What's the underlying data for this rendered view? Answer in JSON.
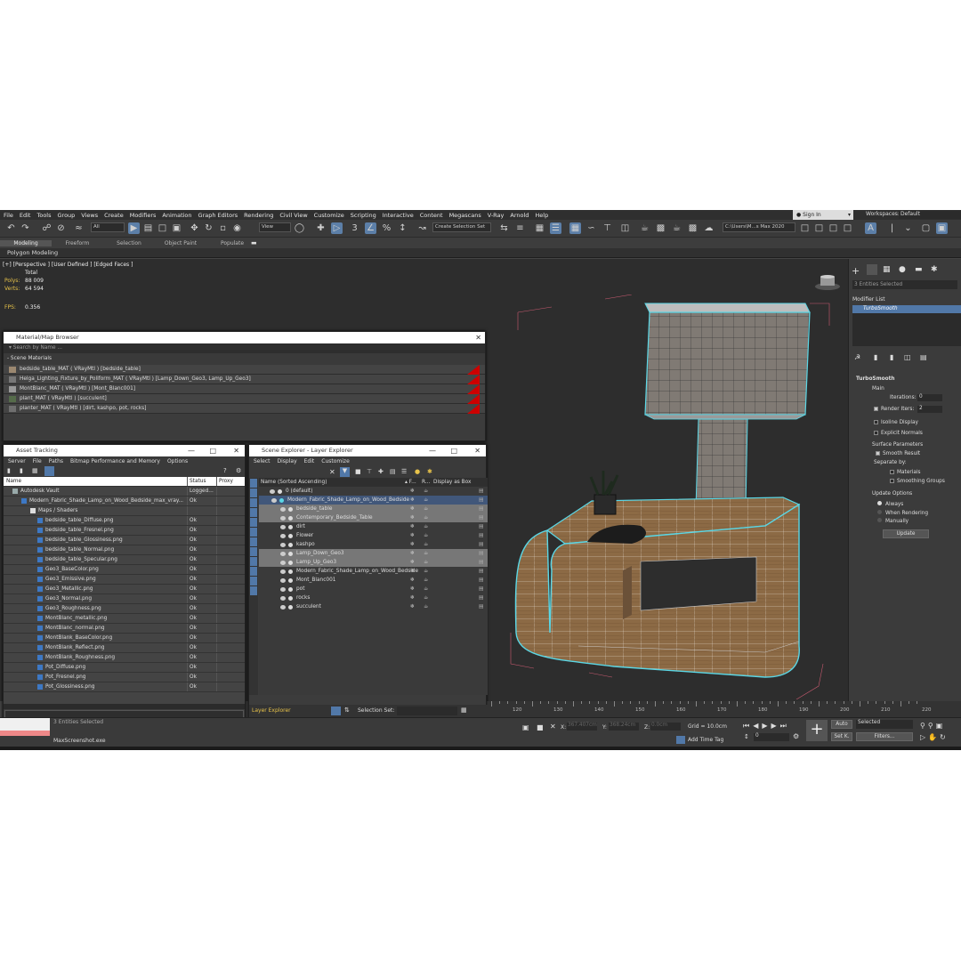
{
  "menu": [
    "File",
    "Edit",
    "Tools",
    "Group",
    "Views",
    "Create",
    "Modifiers",
    "Animation",
    "Graph Editors",
    "Rendering",
    "Civil View",
    "Customize",
    "Scripting",
    "Interactive",
    "Content",
    "Megascans",
    "V-Ray",
    "Arnold",
    "Help"
  ],
  "topright": {
    "sign_in": "Sign In",
    "workspaces_label": "Workspaces:",
    "workspaces_value": "Default"
  },
  "toolbar": {
    "filter": "All",
    "view": "View",
    "selection_set": "Create Selection Set",
    "path": "C:\\Users\\M...s Max 2020"
  },
  "ribbon": [
    "Modeling",
    "Freeform",
    "Selection",
    "Object Paint",
    "Populate"
  ],
  "polygon_modeling": "Polygon Modeling",
  "viewport": {
    "label": "[+] [Perspective ] [User Defined ] [Edged Faces ]",
    "total": "Total",
    "polys_label": "Polys:",
    "polys": "88 009",
    "verts_label": "Verts:",
    "verts": "64 594",
    "fps_label": "FPS:",
    "fps": "0.356"
  },
  "material_browser": {
    "title": "Material/Map Browser",
    "search_placeholder": "Search by Name ...",
    "section": "- Scene Materials",
    "items": [
      "bedside_table_MAT  ( VRayMtl )  [bedside_table]",
      "Helga_Lighting_Fixture_by_Poliform_MAT  ( VRayMtl )  [Lamp_Down_Geo3, Lamp_Up_Geo3]",
      "MontBlanc_MAT  ( VRayMtl )  [Mont_Blanc001]",
      "plant_MAT  ( VRayMtl )  [succulent]",
      "planter_MAT  ( VRayMtl )  [dirt, kashpo, pot, rocks]"
    ]
  },
  "asset_tracking": {
    "title": "Asset Tracking",
    "menu": [
      "Server",
      "File",
      "Paths",
      "Bitmap Performance and Memory",
      "Options"
    ],
    "columns": [
      "Name",
      "Status",
      "Proxy"
    ],
    "rows": [
      {
        "name": "Autodesk Vault",
        "status": "Logged..."
      },
      {
        "name": "Modern_Fabric_Shade_Lamp_on_Wood_Bedside_max_vray...",
        "status": "Ok"
      },
      {
        "name": "Maps / Shaders",
        "status": ""
      },
      {
        "name": "bedside_table_Diffuse.png",
        "status": "Ok"
      },
      {
        "name": "bedside_table_Fresnel.png",
        "status": "Ok"
      },
      {
        "name": "bedside_table_Glossiness.png",
        "status": "Ok"
      },
      {
        "name": "bedside_table_Normal.png",
        "status": "Ok"
      },
      {
        "name": "bedside_table_Specular.png",
        "status": "Ok"
      },
      {
        "name": "Geo3_BaseColor.png",
        "status": "Ok"
      },
      {
        "name": "Geo3_Emissive.png",
        "status": "Ok"
      },
      {
        "name": "Geo3_Metallic.png",
        "status": "Ok"
      },
      {
        "name": "Geo3_Normal.png",
        "status": "Ok"
      },
      {
        "name": "Geo3_Roughness.png",
        "status": "Ok"
      },
      {
        "name": "MontBlanc_metallic.png",
        "status": "Ok"
      },
      {
        "name": "MontBlanc_normal.png",
        "status": "Ok"
      },
      {
        "name": "MontBlank_BaseColor.png",
        "status": "Ok"
      },
      {
        "name": "MontBlank_Reflect.png",
        "status": "Ok"
      },
      {
        "name": "MontBlank_Roughness.png",
        "status": "Ok"
      },
      {
        "name": "Pot_Diffuse.png",
        "status": "Ok"
      },
      {
        "name": "Pot_Fresnel.png",
        "status": "Ok"
      },
      {
        "name": "Pot_Glossiness.png",
        "status": "Ok"
      }
    ]
  },
  "scene_explorer": {
    "title": "Scene Explorer - Layer Explorer",
    "menu": [
      "Select",
      "Display",
      "Edit",
      "Customize"
    ],
    "columns": [
      "Name (Sorted Ascending)",
      "▴ F...",
      "R...",
      "Display as Box"
    ],
    "rows": [
      {
        "name": "0 (default)",
        "indent": 1
      },
      {
        "name": "Modern_Fabric_Shade_Lamp_on_Wood_Bedside",
        "indent": 0
      },
      {
        "name": "bedside_table",
        "indent": 2
      },
      {
        "name": "Contemporary_Bedside_Table",
        "indent": 2
      },
      {
        "name": "dirt",
        "indent": 2
      },
      {
        "name": "Flower",
        "indent": 2
      },
      {
        "name": "kashpo",
        "indent": 2
      },
      {
        "name": "Lamp_Down_Geo3",
        "indent": 2
      },
      {
        "name": "Lamp_Up_Geo3",
        "indent": 2
      },
      {
        "name": "Modern_Fabric_Shade_Lamp_on_Wood_Bedside",
        "indent": 2
      },
      {
        "name": "Mont_Blanc001",
        "indent": 2
      },
      {
        "name": "pot",
        "indent": 2
      },
      {
        "name": "rocks",
        "indent": 2
      },
      {
        "name": "succulent",
        "indent": 2
      }
    ],
    "footer_label": "Layer Explorer",
    "selection_set_label": "Selection Set:"
  },
  "command_panel": {
    "selected_count": "3 Entities Selected",
    "modifier_list": "Modifier List",
    "modifier": "TurboSmooth",
    "rollout_title": "TurboSmooth",
    "main": "Main",
    "iterations_label": "Iterations:",
    "iterations": "0",
    "render_iters_label": "Render Iters:",
    "render_iters": "2",
    "isoline": "Isoline Display",
    "explicit_normals": "Explicit Normals",
    "surface_params": "Surface Parameters",
    "smooth_result": "Smooth Result",
    "separate_by": "Separate by:",
    "materials": "Materials",
    "smoothing_groups": "Smoothing Groups",
    "update_options": "Update Options",
    "always": "Always",
    "when_rendering": "When Rendering",
    "manually": "Manually",
    "update_btn": "Update"
  },
  "status": {
    "entities": "3 Entities Selected",
    "exe": "MaxScreenshot.exe",
    "x_label": "X:",
    "x": "367.407cm",
    "y_label": "Y:",
    "y": "368.24cm",
    "z_label": "Z:",
    "z": "0.0cm",
    "grid": "Grid = 10.0cm",
    "add_time_tag": "Add Time Tag",
    "frame": "0",
    "auto": "Auto",
    "selected": "Selected",
    "set_k": "Set K.",
    "filters": "Filters..."
  },
  "ruler_ticks": [
    "120",
    "130",
    "140",
    "150",
    "160",
    "170",
    "180",
    "190",
    "200",
    "210",
    "220"
  ]
}
